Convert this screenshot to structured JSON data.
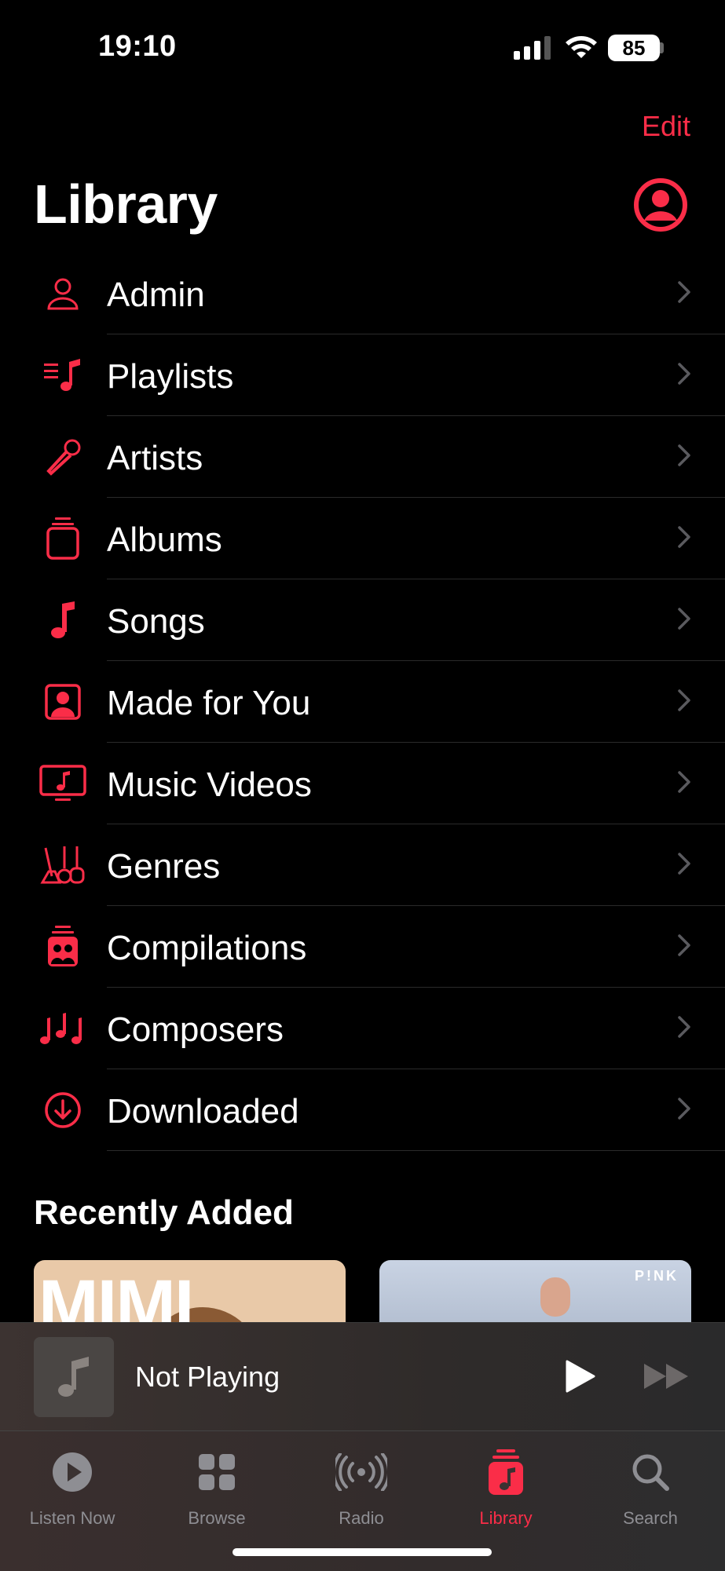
{
  "status_bar": {
    "time": "19:10",
    "battery": "85",
    "icons": [
      "cellular-signal-icon",
      "wifi-icon",
      "battery-icon"
    ]
  },
  "header": {
    "edit_label": "Edit",
    "title": "Library",
    "profile_icon": "person-circle-icon"
  },
  "library_items": [
    {
      "label": "Admin",
      "icon": "person-icon"
    },
    {
      "label": "Playlists",
      "icon": "playlist-icon"
    },
    {
      "label": "Artists",
      "icon": "microphone-icon"
    },
    {
      "label": "Albums",
      "icon": "album-stack-icon"
    },
    {
      "label": "Songs",
      "icon": "music-note-icon"
    },
    {
      "label": "Made for You",
      "icon": "person-square-icon"
    },
    {
      "label": "Music Videos",
      "icon": "tv-music-icon"
    },
    {
      "label": "Genres",
      "icon": "guitars-icon"
    },
    {
      "label": "Compilations",
      "icon": "compilation-stack-icon"
    },
    {
      "label": "Composers",
      "icon": "music-notes-icon"
    },
    {
      "label": "Downloaded",
      "icon": "download-circle-icon"
    }
  ],
  "recently_added": {
    "heading": "Recently Added",
    "albums": [
      {
        "cover_text": "MIMI WEBB"
      },
      {
        "cover_text": "P!NK"
      }
    ]
  },
  "mini_player": {
    "title": "Not Playing"
  },
  "tab_bar": {
    "tabs": [
      {
        "label": "Listen Now",
        "icon": "play-circle-icon"
      },
      {
        "label": "Browse",
        "icon": "grid-icon"
      },
      {
        "label": "Radio",
        "icon": "radio-waves-icon"
      },
      {
        "label": "Library",
        "icon": "library-music-icon",
        "active": true
      },
      {
        "label": "Search",
        "icon": "magnifying-glass-icon"
      }
    ]
  },
  "colors": {
    "accent": "#fa2d48",
    "background": "#000000",
    "inactive": "#8e8e93"
  }
}
